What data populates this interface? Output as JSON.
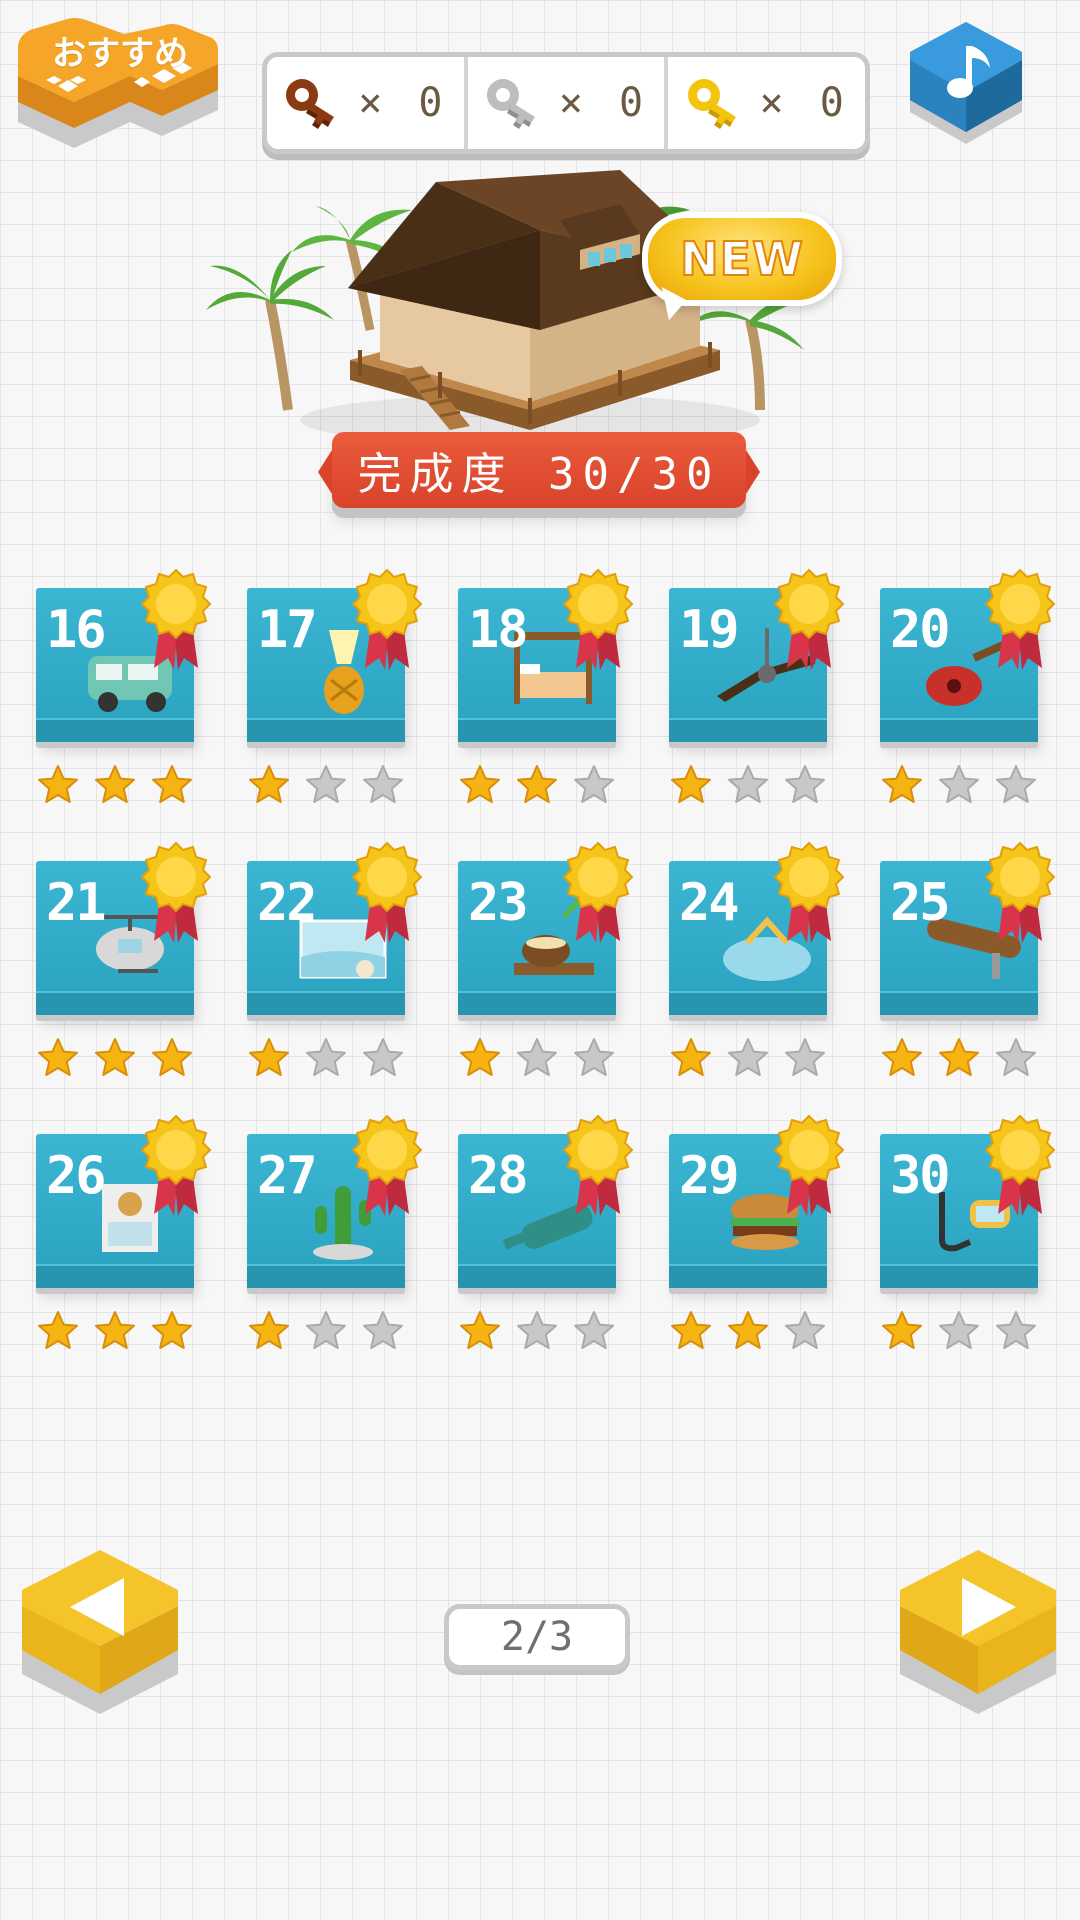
{
  "header": {
    "recommend_label": "おすすめ",
    "music_icon": "music-note-icon"
  },
  "keys": [
    {
      "icon": "bronze-key-icon",
      "color": "#8b3a12",
      "count": "× 0"
    },
    {
      "icon": "silver-key-icon",
      "color": "#b5b5b5",
      "count": "× 0"
    },
    {
      "icon": "gold-key-icon",
      "color": "#f2c40c",
      "count": "× 0"
    }
  ],
  "house": {
    "new_badge": "NEW",
    "progress_label": "完成度 30/30"
  },
  "levels": [
    {
      "number": "16",
      "item": "camper-van",
      "stars": 3,
      "medal": true
    },
    {
      "number": "17",
      "item": "pineapple-lamp",
      "stars": 1,
      "medal": true
    },
    {
      "number": "18",
      "item": "canopy-bed",
      "stars": 2,
      "medal": true
    },
    {
      "number": "19",
      "item": "ceiling-fan",
      "stars": 1,
      "medal": true
    },
    {
      "number": "20",
      "item": "ukulele",
      "stars": 1,
      "medal": true
    },
    {
      "number": "21",
      "item": "helicopter",
      "stars": 3,
      "medal": true
    },
    {
      "number": "22",
      "item": "aquarium",
      "stars": 1,
      "medal": true
    },
    {
      "number": "23",
      "item": "coconut-drink",
      "stars": 1,
      "medal": true
    },
    {
      "number": "24",
      "item": "sandal",
      "stars": 1,
      "medal": true
    },
    {
      "number": "25",
      "item": "surfboard",
      "stars": 2,
      "medal": true
    },
    {
      "number": "26",
      "item": "clock-cabinet",
      "stars": 3,
      "medal": true
    },
    {
      "number": "27",
      "item": "cactus",
      "stars": 1,
      "medal": true
    },
    {
      "number": "28",
      "item": "bottle",
      "stars": 1,
      "medal": true
    },
    {
      "number": "29",
      "item": "hamburger",
      "stars": 2,
      "medal": true
    },
    {
      "number": "30",
      "item": "snorkel",
      "stars": 1,
      "medal": true
    }
  ],
  "pagination": {
    "page_label": "2/3",
    "prev_icon": "left-arrow-icon",
    "next_icon": "right-arrow-icon"
  },
  "colors": {
    "tile_blue": "#2ea8c6",
    "star_gold": "#f6b412",
    "star_gray": "#c8c8c8",
    "banner_red": "#e04d30",
    "hex_orange": "#f0a02a",
    "hex_yellow": "#f3c21c",
    "hex_blue": "#2f8ed1"
  }
}
